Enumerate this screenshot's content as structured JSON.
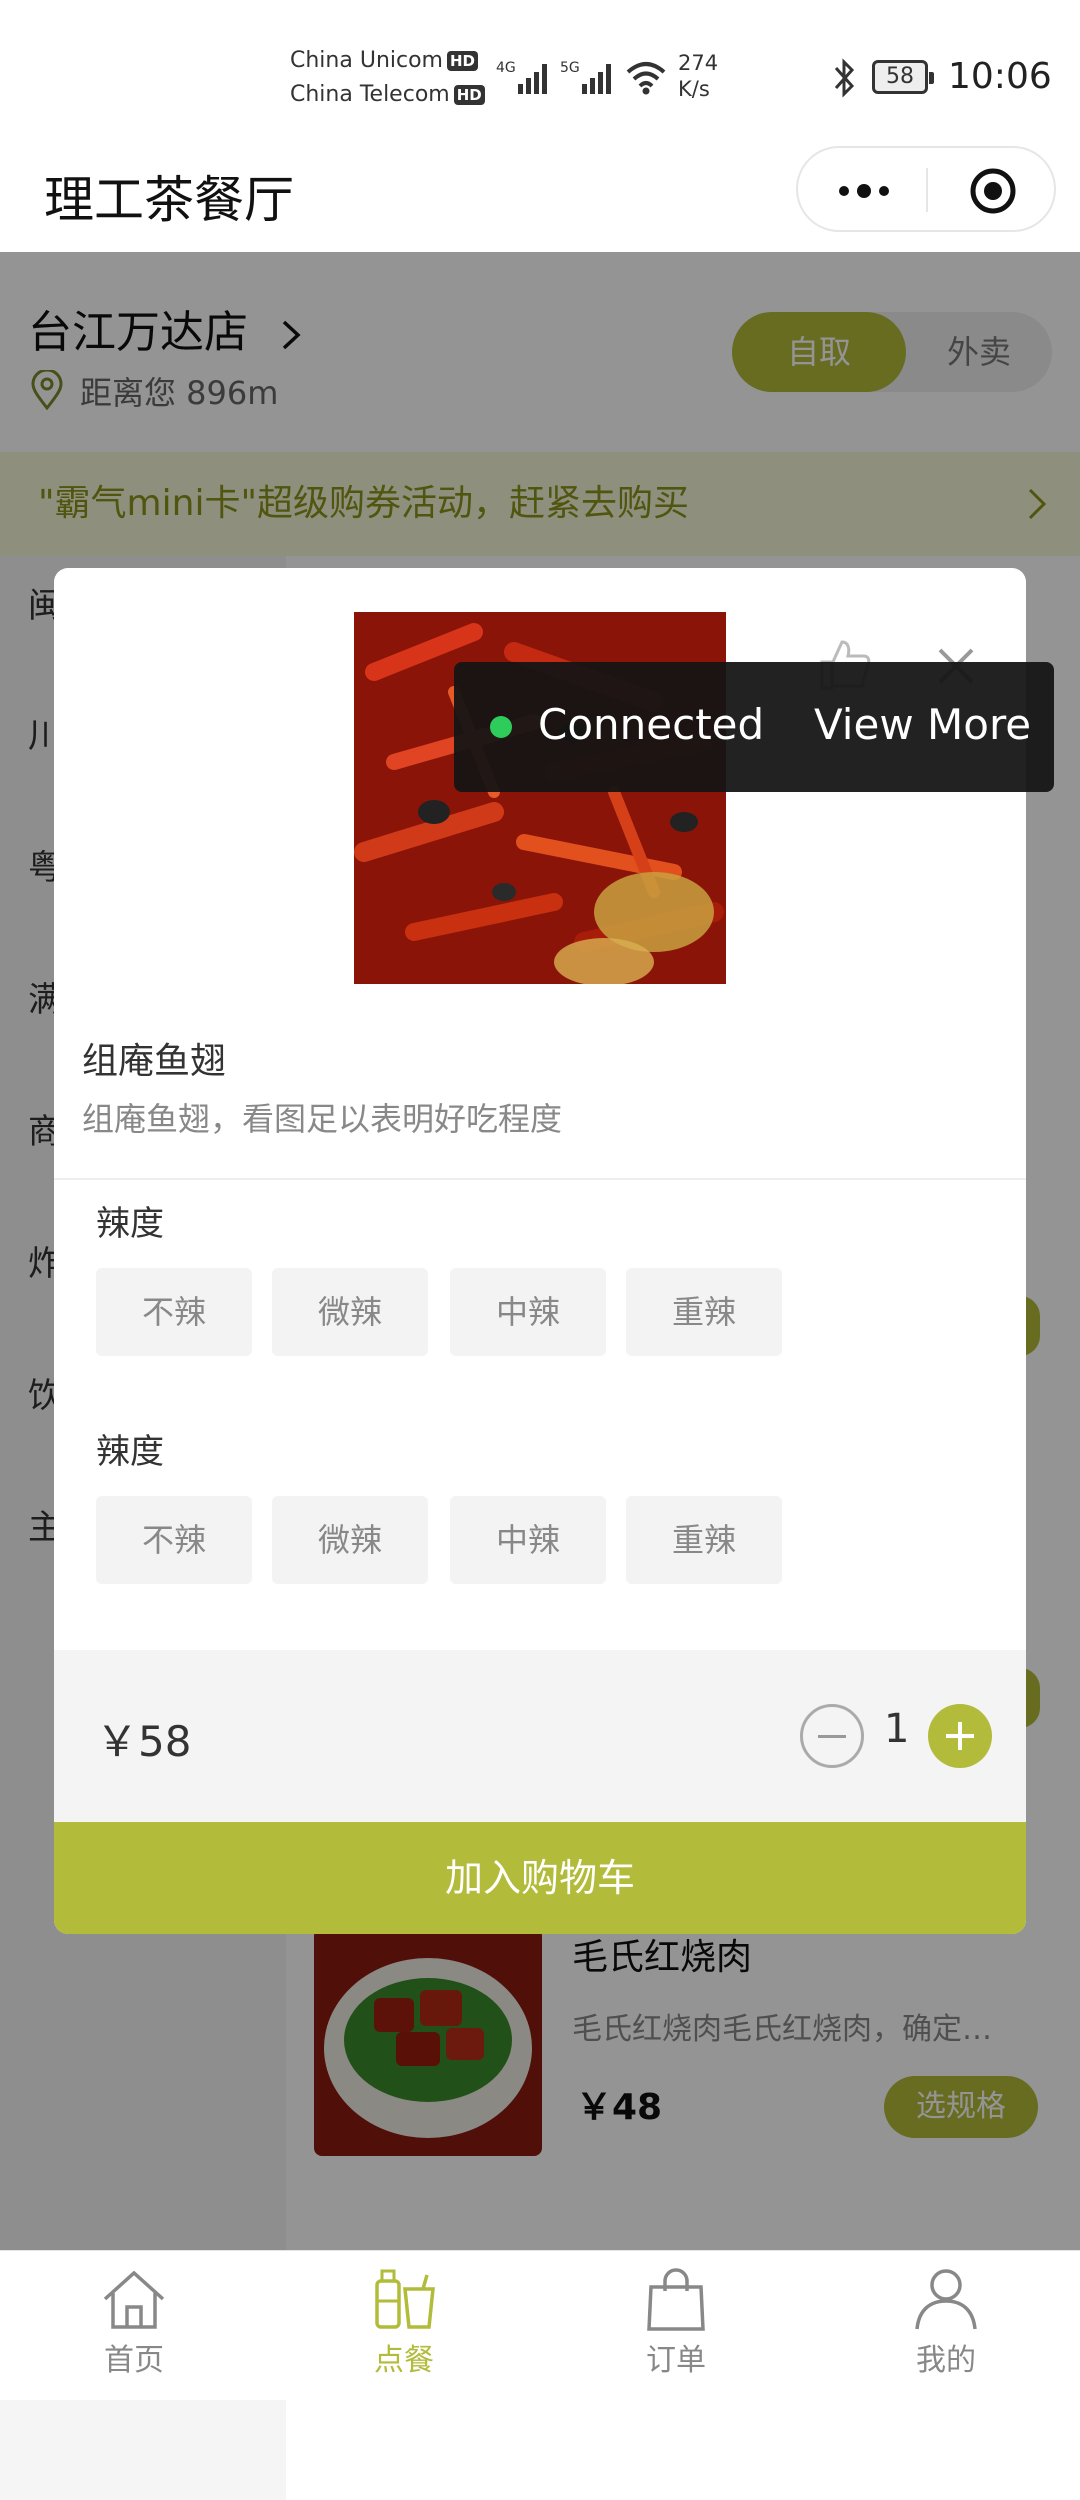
{
  "status_bar": {
    "carrier1": "China Unicom",
    "carrier2": "China Telecom",
    "hd": "HD",
    "net_speed_value": "274",
    "net_speed_unit": "K/s",
    "battery": "58",
    "time": "10:06"
  },
  "app": {
    "title": "理工茶餐厅"
  },
  "store": {
    "name": "台江万达店",
    "distance": "距离您 896m",
    "mode_active": "自取",
    "mode_other": "外卖"
  },
  "promo": {
    "text": "\"霸气mini卡\"超级购券活动，赶紧去购买"
  },
  "categories": [
    "闽",
    "川",
    "粤",
    "满",
    "商",
    "炸",
    "饮",
    "主"
  ],
  "background_dish": {
    "name": "毛氏红烧肉",
    "desc": "毛氏红烧肉毛氏红烧肉，确定…",
    "price": "￥48",
    "spec_button": "选规格"
  },
  "toast": {
    "status": "Connected",
    "action": "View More"
  },
  "modal": {
    "dish_name": "组庵鱼翅",
    "dish_desc": "组庵鱼翅，看图足以表明好吃程度",
    "groups": [
      {
        "label": "辣度",
        "options": [
          "不辣",
          "微辣",
          "中辣",
          "重辣"
        ]
      },
      {
        "label": "辣度",
        "options": [
          "不辣",
          "微辣",
          "中辣",
          "重辣"
        ]
      }
    ],
    "price": "￥58",
    "quantity": "1",
    "add_to_cart": "加入购物车"
  },
  "tabbar": {
    "items": [
      {
        "label": "首页",
        "icon": "home-icon"
      },
      {
        "label": "点餐",
        "icon": "drinks-icon",
        "active": true
      },
      {
        "label": "订单",
        "icon": "bag-icon"
      },
      {
        "label": "我的",
        "icon": "user-icon"
      }
    ]
  },
  "colors": {
    "accent": "#b2bb3a",
    "toast_dot": "#2ecc5b"
  }
}
